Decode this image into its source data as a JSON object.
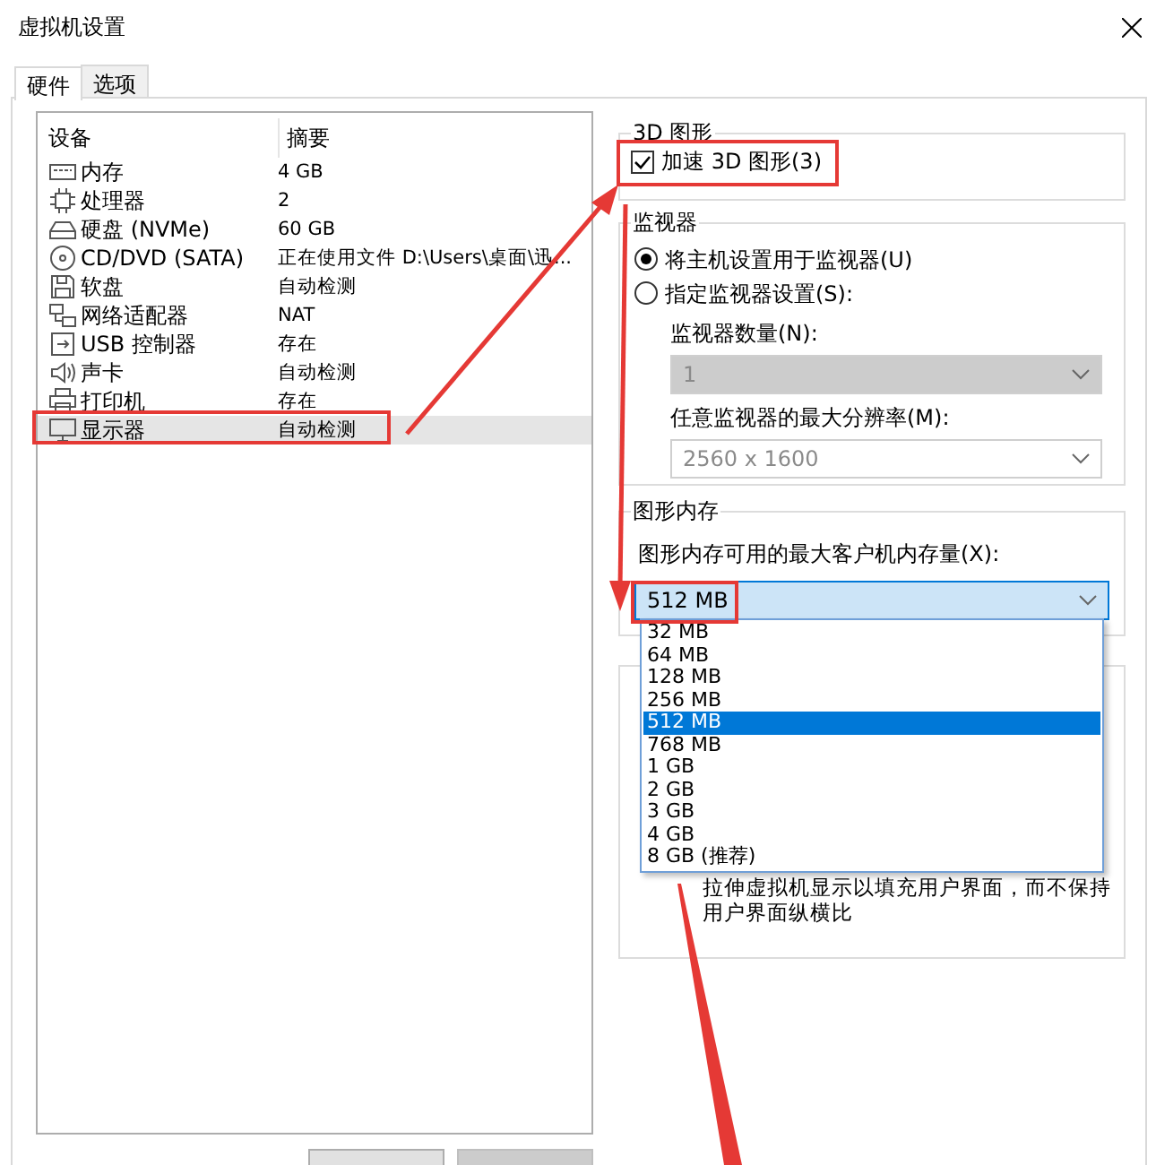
{
  "window": {
    "title": "虚拟机设置"
  },
  "tabs": [
    {
      "label": "硬件",
      "selected": true
    },
    {
      "label": "选项",
      "selected": false
    }
  ],
  "device_list": {
    "columns": [
      "设备",
      "摘要"
    ],
    "rows": [
      {
        "kind": "memory",
        "device": "内存",
        "summary": "4 GB",
        "selected": false
      },
      {
        "kind": "cpu",
        "device": "处理器",
        "summary": "2",
        "selected": false
      },
      {
        "kind": "disk",
        "device": "硬盘 (NVMe)",
        "summary": "60 GB",
        "selected": false
      },
      {
        "kind": "cd",
        "device": "CD/DVD (SATA)",
        "summary": "正在使用文件 D:\\Users\\桌面\\迅...",
        "selected": false
      },
      {
        "kind": "floppy",
        "device": "软盘",
        "summary": "自动检测",
        "selected": false
      },
      {
        "kind": "network",
        "device": "网络适配器",
        "summary": "NAT",
        "selected": false
      },
      {
        "kind": "usb",
        "device": "USB 控制器",
        "summary": "存在",
        "selected": false
      },
      {
        "kind": "sound",
        "device": "声卡",
        "summary": "自动检测",
        "selected": false
      },
      {
        "kind": "printer",
        "device": "打印机",
        "summary": "存在",
        "selected": false
      },
      {
        "kind": "display",
        "device": "显示器",
        "summary": "自动检测",
        "selected": true
      }
    ]
  },
  "graphics_3d": {
    "title": "3D 图形",
    "checkbox": {
      "label": "加速 3D 图形(3)",
      "checked": true
    }
  },
  "monitors": {
    "title": "监视器",
    "options": [
      {
        "label": "将主机设置用于监视器(U)",
        "selected": true
      },
      {
        "label": "指定监视器设置(S):",
        "selected": false
      }
    ],
    "count": {
      "label": "监视器数量(N):",
      "value": "1",
      "disabled": true
    },
    "resolution": {
      "label": "任意监视器的最大分辨率(M):",
      "value": "2560 x 1600",
      "disabled": true
    }
  },
  "graphics_memory": {
    "title": "图形内存",
    "label": "图形内存可用的最大客户机内存量(X):",
    "value": "512 MB",
    "expanded": true,
    "options": [
      {
        "label": "32 MB",
        "selected": false
      },
      {
        "label": "64 MB",
        "selected": false
      },
      {
        "label": "128 MB",
        "selected": false
      },
      {
        "label": "256 MB",
        "selected": false
      },
      {
        "label": "512 MB",
        "selected": true
      },
      {
        "label": "768 MB",
        "selected": false
      },
      {
        "label": "1 GB",
        "selected": false
      },
      {
        "label": "2 GB",
        "selected": false
      },
      {
        "label": "3 GB",
        "selected": false
      },
      {
        "label": "4 GB",
        "selected": false
      },
      {
        "label": "8 GB (推荐)",
        "selected": false
      }
    ]
  },
  "display_scaling": {
    "description": "拉伸虚拟机显示以填充用户界面，而不保持用户界面纵横比"
  }
}
